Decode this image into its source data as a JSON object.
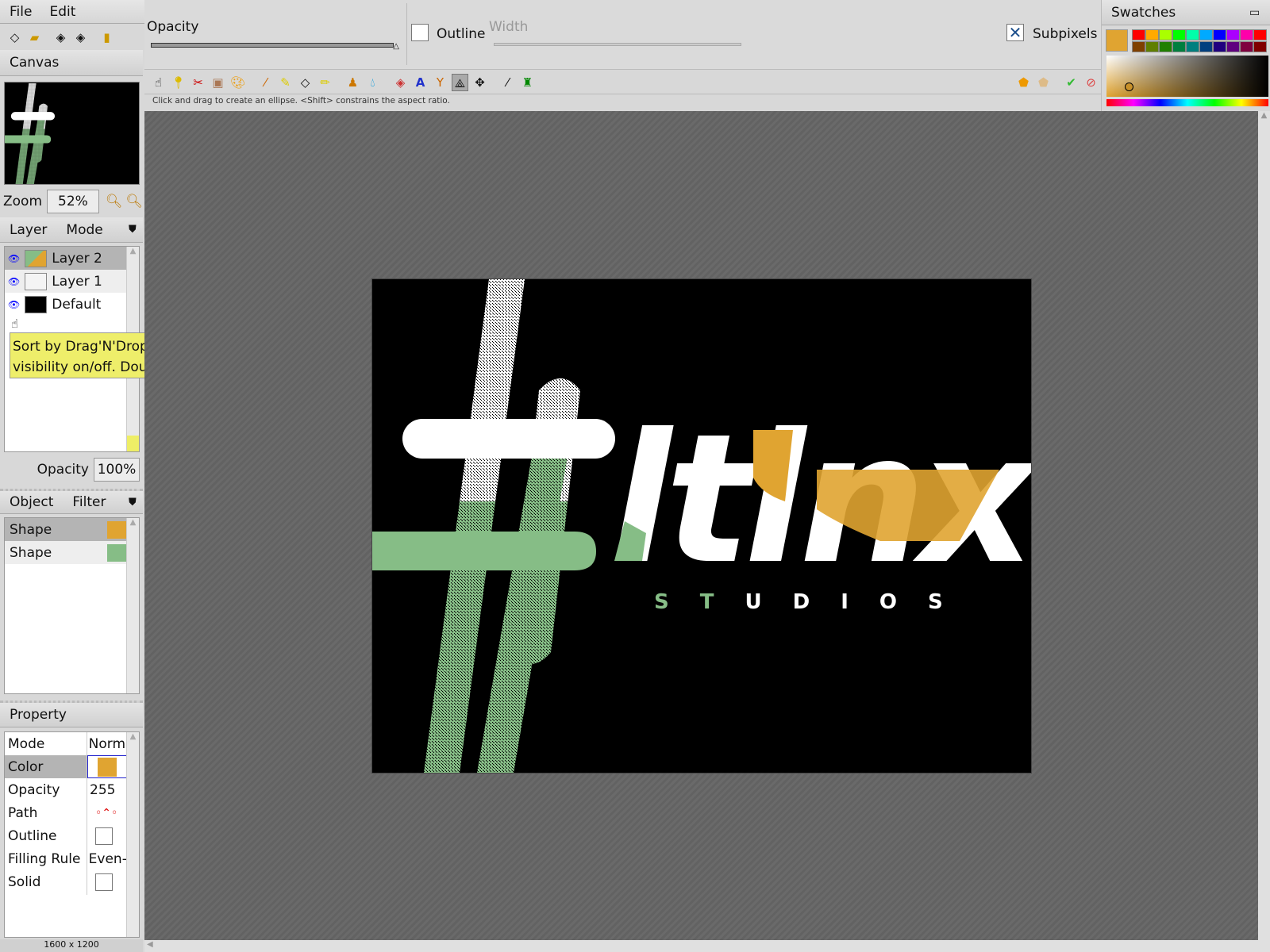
{
  "menu": {
    "file": "File",
    "edit": "Edit"
  },
  "canvas_panel": {
    "title": "Canvas",
    "zoom_label": "Zoom",
    "zoom_value": "52%"
  },
  "layer_panel": {
    "tab_layer": "Layer",
    "tab_mode": "Mode",
    "layers": [
      {
        "name": "Layer 2"
      },
      {
        "name": "Layer 1"
      },
      {
        "name": "Default"
      }
    ],
    "tooltip": "Sort by Drag'N'Drop. Click eye icon to turn visibility on/off. Doubleclick to change name.",
    "opacity_label": "Opacity",
    "opacity_value": "100%"
  },
  "object_panel": {
    "tab_object": "Object",
    "tab_filter": "Filter",
    "objects": [
      {
        "name": "Shape",
        "color": "#e0a431"
      },
      {
        "name": "Shape",
        "color": "#86bd86"
      }
    ]
  },
  "property_panel": {
    "title": "Property",
    "rows": [
      {
        "label": "Mode",
        "value": "Norm"
      },
      {
        "label": "Color",
        "value": ""
      },
      {
        "label": "Opacity",
        "value": "255"
      },
      {
        "label": "Path",
        "value": ""
      },
      {
        "label": "Outline",
        "value": ""
      },
      {
        "label": "Filling Rule",
        "value": "Even-"
      },
      {
        "label": "Solid",
        "value": ""
      }
    ],
    "color": "#e0a431"
  },
  "status": {
    "size": "1600 x 1200"
  },
  "options": {
    "opacity_label": "Opacity",
    "opacity_fraction": 1.0,
    "outline_label": "Outline",
    "outline_checked": false,
    "width_label": "Width",
    "subpixels_label": "Subpixels",
    "subpixels_checked": true
  },
  "hint": "Click and drag to create an ellipse. <Shift> constrains the aspect ratio.",
  "swatches": {
    "title": "Swatches",
    "current": "#e0a431",
    "row1": [
      "#ff0000",
      "#ffaa00",
      "#aaff00",
      "#00ff00",
      "#00ffaa",
      "#00aaff",
      "#0000ff",
      "#aa00ff",
      "#ff00aa",
      "#ff0000"
    ],
    "row2": [
      "#7f4000",
      "#5f7f00",
      "#1f7f00",
      "#007f3f",
      "#007f7f",
      "#003f7f",
      "#1f007f",
      "#5f007f",
      "#7f003f",
      "#7f0000"
    ]
  },
  "artwork": {
    "logo_word": "ltlnx",
    "logo_sub": "STUDIOS",
    "colors": {
      "orange": "#e0a431",
      "green": "#86bd86",
      "white": "#ffffff",
      "bg": "#000000"
    }
  }
}
